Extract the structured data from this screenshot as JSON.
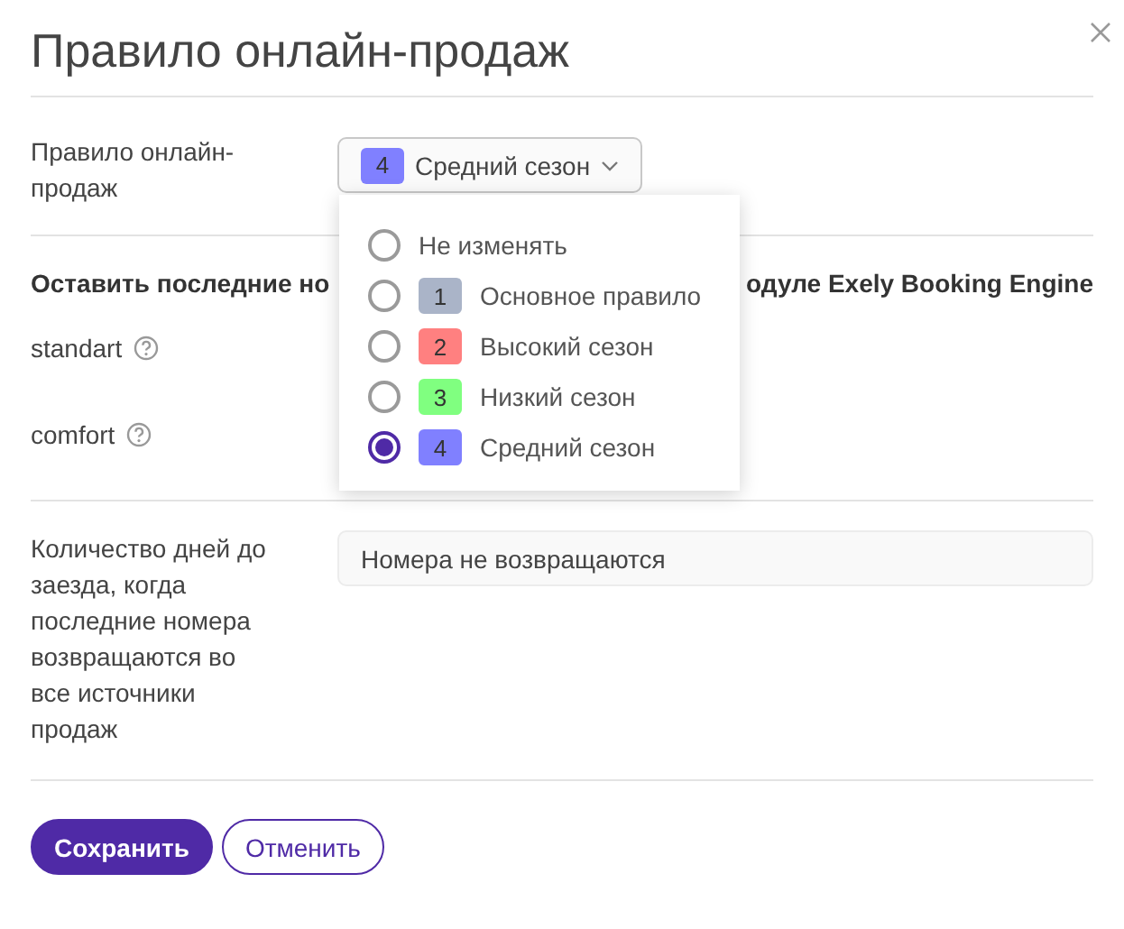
{
  "dialog": {
    "title": "Правило онлайн-продаж"
  },
  "rule_field": {
    "label": "Правило онлайн-продаж",
    "expanded": true,
    "value": {
      "badge": "4",
      "color": "#8080ff",
      "label": "Средний сезон"
    },
    "options": [
      {
        "label": "Не изменять",
        "selected": false
      },
      {
        "badge": "1",
        "color": "#aab4c8",
        "label": "Основное правило",
        "selected": false
      },
      {
        "badge": "2",
        "color": "#ff8080",
        "label": "Высокий сезон",
        "selected": false
      },
      {
        "badge": "3",
        "color": "#80ff80",
        "label": "Низкий сезон",
        "selected": false
      },
      {
        "badge": "4",
        "color": "#8080ff",
        "label": "Средний сезон",
        "selected": true
      }
    ]
  },
  "section_heading": {
    "visible_start": "Оставить последние но",
    "visible_end": "одуле Exely Booking Engine"
  },
  "room_types": [
    {
      "label": "standart"
    },
    {
      "label": "comfort"
    }
  ],
  "days_field": {
    "label": "Количество дней до заезда, когда последние номера возвращаются во все источники продаж",
    "value": "Номера не возвращаются"
  },
  "buttons": [
    {
      "label": "Сохранить",
      "kind": "primary"
    },
    {
      "label": "Отменить",
      "kind": "secondary"
    }
  ]
}
